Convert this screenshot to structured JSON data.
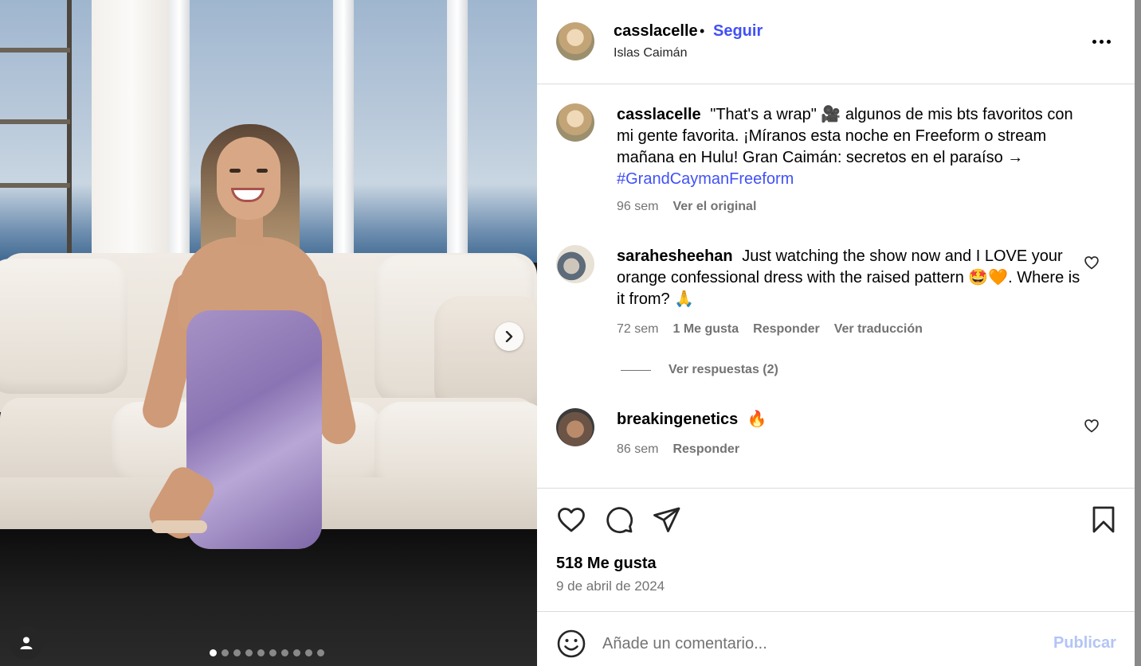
{
  "post": {
    "author": "casslacelle",
    "follow_label": "Seguir",
    "bullet": "•",
    "location": "Islas Caimán"
  },
  "caption": {
    "username": "casslacelle",
    "text": "\"That's a wrap\" 🎥 algunos de mis bts favoritos con mi gente favorita. ¡Míranos esta noche en Freeform o stream mañana en Hulu! Gran Caimán: secretos en el paraíso →",
    "hashtag": "#GrandCaymanFreeform",
    "time": "96 sem",
    "see_original": "Ver el original"
  },
  "comments": [
    {
      "username": "sarahesheehan",
      "text": "Just watching the show now and I LOVE your orange confessional dress with the raised pattern 🤩🧡. Where is it from? 🙏",
      "time": "72 sem",
      "likes": "1 Me gusta",
      "reply": "Responder",
      "translate": "Ver traducción",
      "view_replies": "Ver respuestas (2)"
    },
    {
      "username": "breakingenetics",
      "text": "🔥",
      "time": "86 sem",
      "reply": "Responder"
    }
  ],
  "stats": {
    "likes": "518 Me gusta",
    "date": "9 de abril de 2024"
  },
  "composer": {
    "placeholder": "Añade un comentario...",
    "publish": "Publicar"
  },
  "carousel": {
    "current_slide": 1,
    "slide_count": 10
  },
  "colors": {
    "link_blue": "#4150f7",
    "publish_disabled": "#b3c4f7",
    "muted": "#737373"
  }
}
